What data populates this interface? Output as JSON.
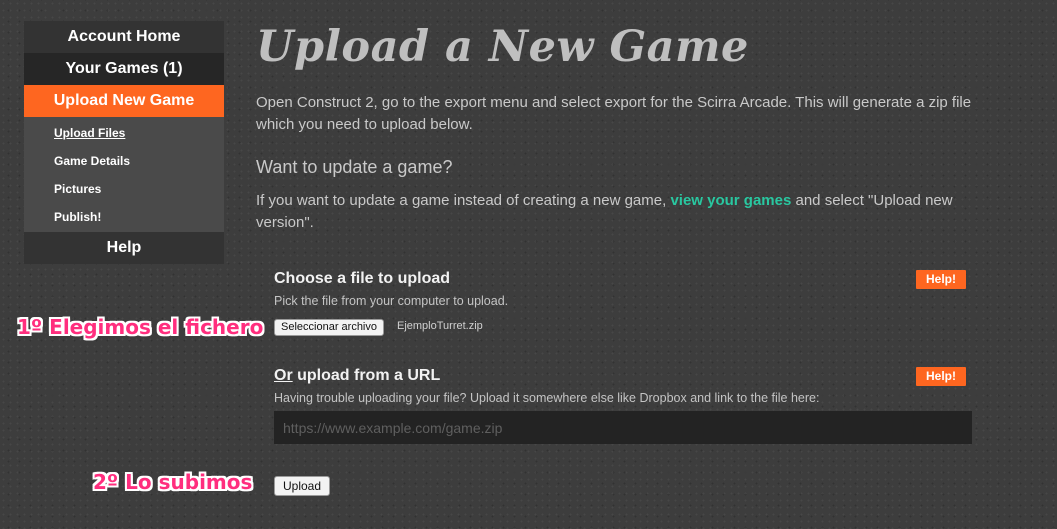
{
  "sidebar": {
    "account_home": "Account Home",
    "your_games": "Your Games (1)",
    "upload_new_game": "Upload New Game",
    "sub_items": [
      {
        "label": "Upload Files"
      },
      {
        "label": "Game Details"
      },
      {
        "label": "Pictures"
      },
      {
        "label": "Publish!"
      }
    ],
    "help": "Help"
  },
  "main": {
    "title": "Upload a New Game",
    "intro": "Open Construct 2, go to the export menu and select export for the Scirra Arcade. This will generate a zip file which you need to upload below.",
    "update_heading": "Want to update a game?",
    "update_text_before": "If you want to update a game instead of creating a new game, ",
    "update_link": "view your games",
    "update_text_after": " and select \"Upload new version\"."
  },
  "file_section": {
    "title": "Choose a file to upload",
    "description": "Pick the file from your computer to upload.",
    "help_label": "Help!",
    "file_button_label": "Seleccionar archivo",
    "file_name": "EjemploTurret.zip"
  },
  "url_section": {
    "title_or": "Or",
    "title_rest": " upload from a URL",
    "description": "Having trouble uploading your file? Upload it somewhere else like Dropbox and link to the file here:",
    "help_label": "Help!",
    "placeholder": "https://www.example.com/game.zip"
  },
  "upload_button_label": "Upload",
  "annotations": {
    "step1": "1º Elegimos el fichero",
    "step2": "2º Lo subimos"
  },
  "colors": {
    "accent_orange": "#fe6620",
    "link_teal": "#29c7a0",
    "annotation_pink": "#ff2e7e",
    "background": "#3d3d3d"
  }
}
